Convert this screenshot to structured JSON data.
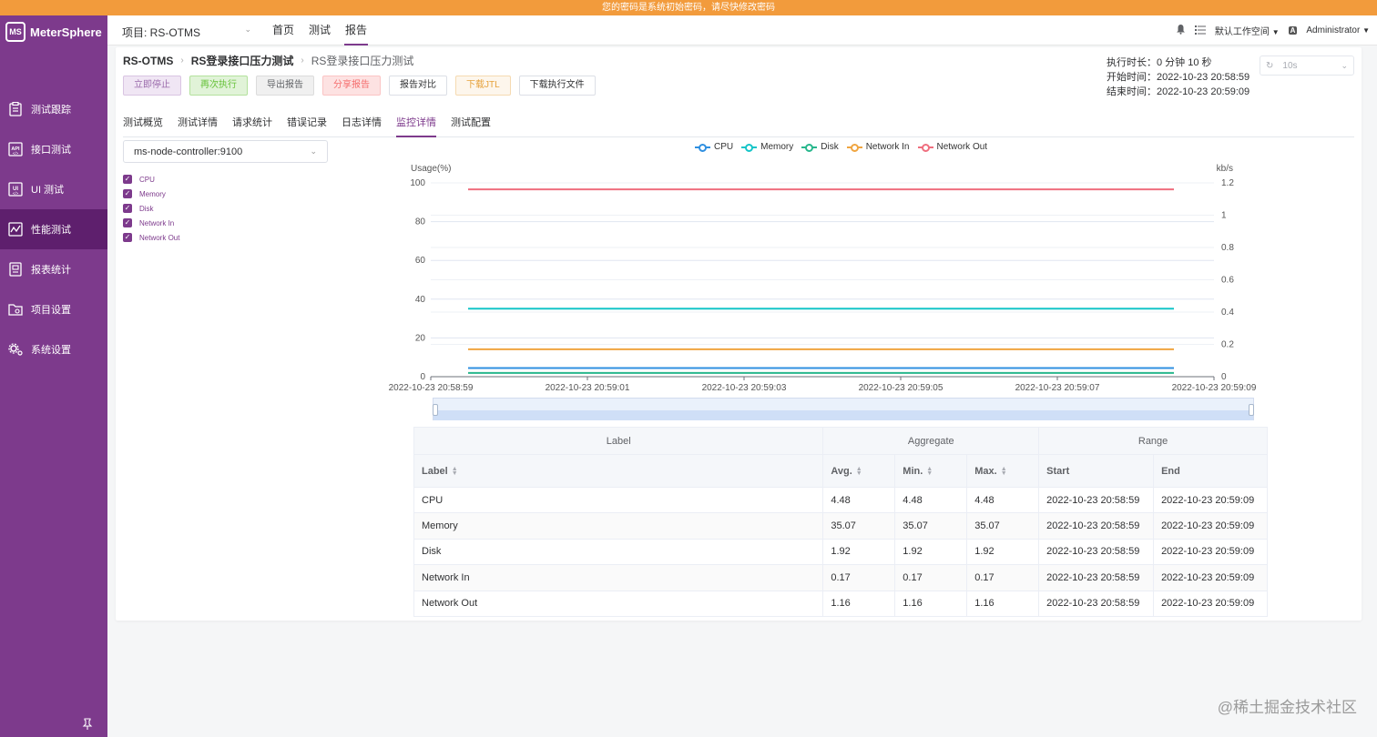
{
  "banner": "您的密码是系统初始密码，请尽快修改密码",
  "brand": {
    "name": "MeterSphere",
    "logo_text": "MS"
  },
  "sidebar": {
    "items": [
      {
        "label": "测试跟踪",
        "icon": "clipboard-icon",
        "active": false
      },
      {
        "label": "接口测试",
        "icon": "api-icon",
        "active": false
      },
      {
        "label": "UI 测试",
        "icon": "ui-icon",
        "active": false
      },
      {
        "label": "性能测试",
        "icon": "performance-icon",
        "active": true
      },
      {
        "label": "报表统计",
        "icon": "report-icon",
        "active": false
      },
      {
        "label": "项目设置",
        "icon": "folder-icon",
        "active": false
      },
      {
        "label": "系统设置",
        "icon": "gear-icon",
        "active": false
      }
    ]
  },
  "topbar": {
    "project": "项目: RS-OTMS",
    "menu": [
      "首页",
      "测试",
      "报告"
    ],
    "active_menu": "报告",
    "workspace": "默认工作空间",
    "user": "Administrator"
  },
  "breadcrumb": {
    "project": "RS-OTMS",
    "test": "RS登录接口压力测试",
    "report": "RS登录接口压力测试"
  },
  "buttons": {
    "stop": "立即停止",
    "rerun": "再次执行",
    "export": "导出报告",
    "share": "分享报告",
    "compare": "报告对比",
    "download_jtl": "下载JTL",
    "download_files": "下载执行文件"
  },
  "exec_info": {
    "duration_label": "执行时长：",
    "duration": "0 分钟 10 秒",
    "start_label": "开始时间：",
    "start": "2022-10-23 20:58:59",
    "end_label": "结束时间：",
    "end": "2022-10-23 20:59:09"
  },
  "refresh": {
    "value": "10s"
  },
  "tabs": [
    "测试概览",
    "测试详情",
    "请求统计",
    "错误记录",
    "日志详情",
    "监控详情",
    "测试配置"
  ],
  "active_tab": "监控详情",
  "node_select": "ms-node-controller:9100",
  "metrics": [
    "CPU",
    "Memory",
    "Disk",
    "Network In",
    "Network Out"
  ],
  "colors": {
    "primary": "#7d3a8c",
    "CPU": "#2f8fe0",
    "Memory": "#15c5c8",
    "Disk": "#28b78d",
    "Network In": "#f0a540",
    "Network Out": "#ef6e7e"
  },
  "chart_data": {
    "type": "line",
    "ylabel": "Usage(%)",
    "y2label": "kb/s",
    "ylim": [
      0,
      100
    ],
    "y_ticks": [
      0,
      20,
      40,
      60,
      80,
      100
    ],
    "y2lim": [
      0,
      1.2
    ],
    "y2_ticks": [
      "0",
      "0.2",
      "0.4",
      "0.6",
      "0.8",
      "1",
      "1.2"
    ],
    "x_ticks": [
      "2022-10-23 20:58:59",
      "2022-10-23 20:59:01",
      "2022-10-23 20:59:03",
      "2022-10-23 20:59:05",
      "2022-10-23 20:59:07",
      "2022-10-23 20:59:09"
    ],
    "grid": true,
    "legend_position": "top",
    "series": [
      {
        "name": "CPU",
        "axis": "left",
        "start": 4.48,
        "end": 4.48
      },
      {
        "name": "Memory",
        "axis": "left",
        "start": 35.07,
        "end": 35.07
      },
      {
        "name": "Disk",
        "axis": "left",
        "start": 1.92,
        "end": 1.92
      },
      {
        "name": "Network In",
        "axis": "right",
        "start": 0.17,
        "end": 0.17
      },
      {
        "name": "Network Out",
        "axis": "right",
        "start": 1.16,
        "end": 1.16
      }
    ]
  },
  "table": {
    "group_headers": [
      "Label",
      "Aggregate",
      "Range"
    ],
    "columns": [
      "Label",
      "Avg.",
      "Min.",
      "Max.",
      "Start",
      "End"
    ],
    "rows": [
      [
        "CPU",
        "4.48",
        "4.48",
        "4.48",
        "2022-10-23 20:58:59",
        "2022-10-23 20:59:09"
      ],
      [
        "Memory",
        "35.07",
        "35.07",
        "35.07",
        "2022-10-23 20:58:59",
        "2022-10-23 20:59:09"
      ],
      [
        "Disk",
        "1.92",
        "1.92",
        "1.92",
        "2022-10-23 20:58:59",
        "2022-10-23 20:59:09"
      ],
      [
        "Network In",
        "0.17",
        "0.17",
        "0.17",
        "2022-10-23 20:58:59",
        "2022-10-23 20:59:09"
      ],
      [
        "Network Out",
        "1.16",
        "1.16",
        "1.16",
        "2022-10-23 20:58:59",
        "2022-10-23 20:59:09"
      ]
    ]
  },
  "watermark": "@稀土掘金技术社区"
}
